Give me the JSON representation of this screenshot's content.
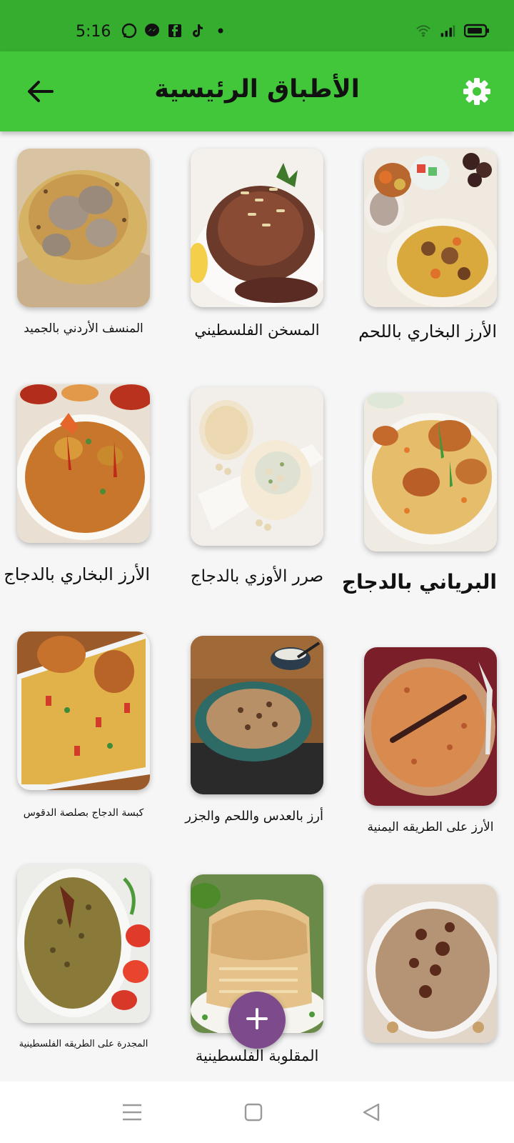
{
  "status_bar": {
    "time": "5:16"
  },
  "header": {
    "title": "الأطباق الرئيسية"
  },
  "dishes": [
    {
      "label": "الأرز البخاري باللحم"
    },
    {
      "label": "المسخن الفلسطيني"
    },
    {
      "label": "المنسف الأردني بالجميد"
    },
    {
      "label": "البرياني بالدجاج"
    },
    {
      "label": "صرر الأوزي بالدجاج"
    },
    {
      "label": "الأرز البخاري بالدجاج"
    },
    {
      "label": "الأرز على الطريقه اليمنية"
    },
    {
      "label": "أرز بالعدس واللحم والجزر"
    },
    {
      "label": "كبسة الدجاج بصلصة الدقوس"
    },
    {
      "label": ""
    },
    {
      "label": "المقلوبة الفلسطينية"
    },
    {
      "label": "المجدرة على الطريقه الفلسطينية"
    }
  ],
  "colors": {
    "status_bar": "#35ad2f",
    "app_bar": "#42c73a",
    "fab": "#7d4b8c",
    "background": "#f6f6f6"
  },
  "icons": {
    "back": "arrow-left-icon",
    "settings": "gear-icon",
    "fab": "plus-icon",
    "nav_recents": "menu-lines-icon",
    "nav_home": "square-icon",
    "nav_back": "triangle-back-icon"
  }
}
